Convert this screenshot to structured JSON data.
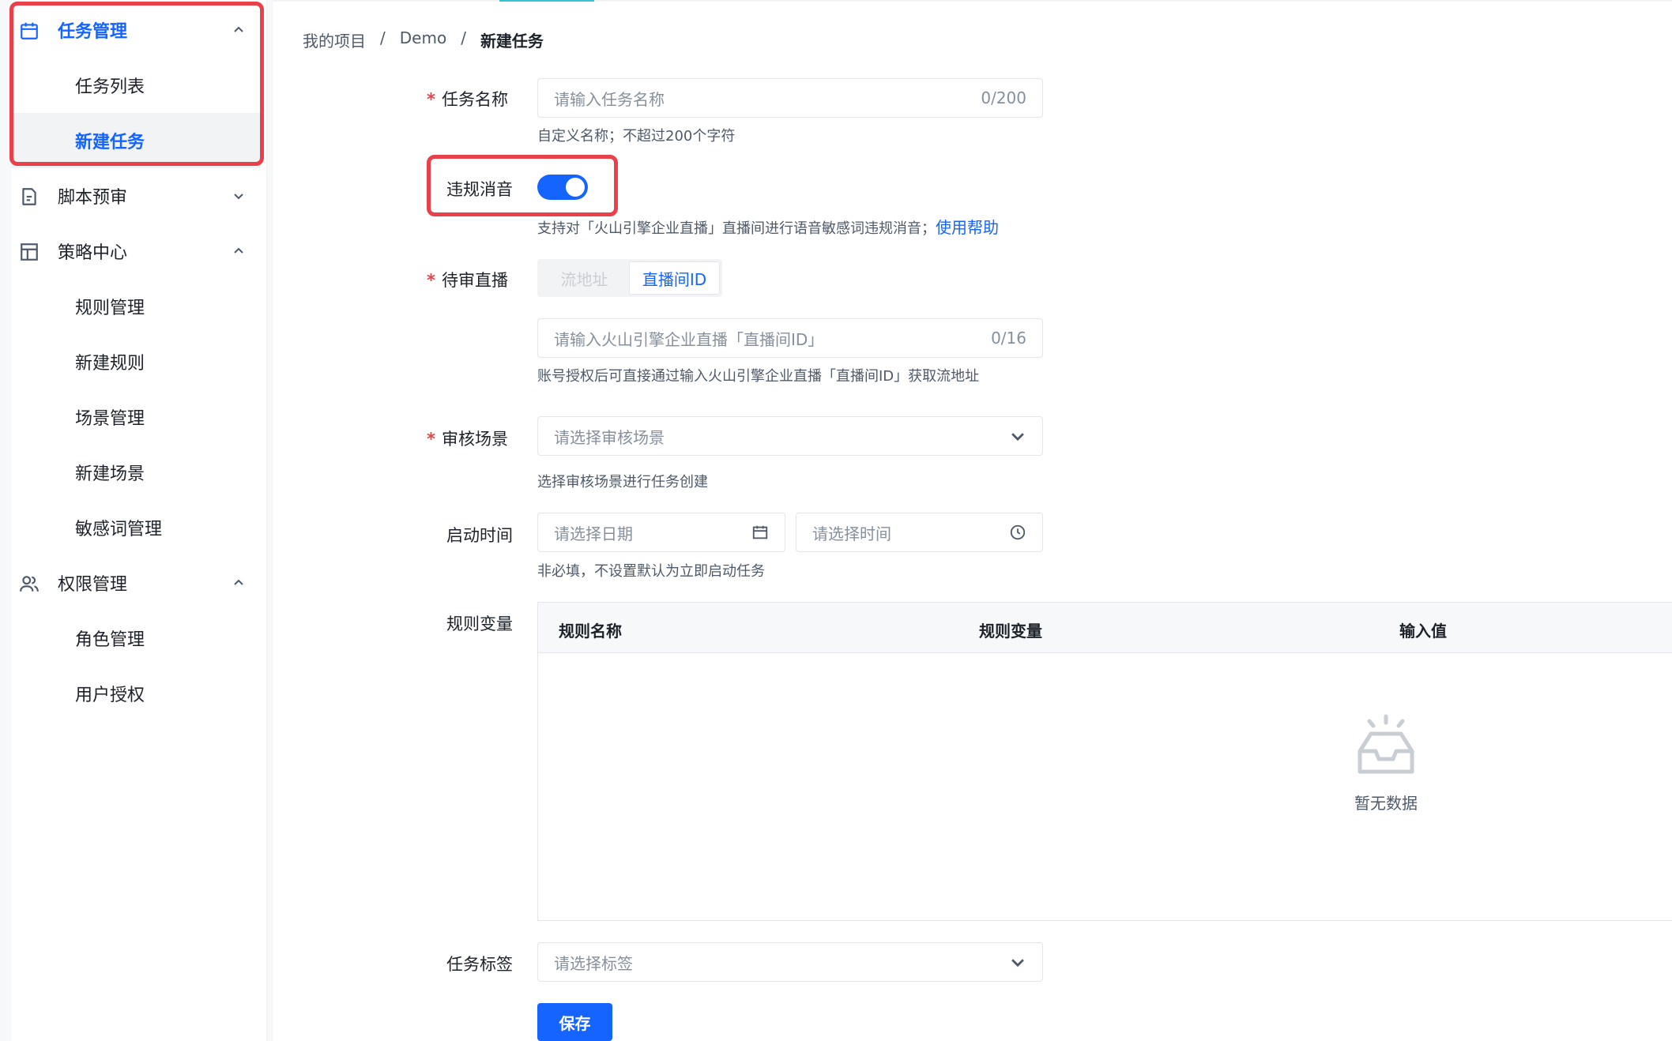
{
  "colors": {
    "primary": "#1664ff",
    "highlight": "#e8414a",
    "required": "#e8414a"
  },
  "sidebar": {
    "groups": [
      {
        "label": "任务管理",
        "icon": "calendar-icon",
        "expanded": true,
        "active": true,
        "items": [
          {
            "label": "任务列表"
          },
          {
            "label": "新建任务",
            "selected": true
          }
        ]
      },
      {
        "label": "脚本预审",
        "icon": "document-icon",
        "expanded": false
      },
      {
        "label": "策略中心",
        "icon": "layout-icon",
        "expanded": true,
        "items": [
          {
            "label": "规则管理"
          },
          {
            "label": "新建规则"
          },
          {
            "label": "场景管理"
          },
          {
            "label": "新建场景"
          },
          {
            "label": "敏感词管理"
          }
        ]
      },
      {
        "label": "权限管理",
        "icon": "users-icon",
        "expanded": true,
        "items": [
          {
            "label": "角色管理"
          },
          {
            "label": "用户授权"
          }
        ]
      }
    ]
  },
  "breadcrumb": {
    "items": [
      "我的项目",
      "Demo",
      "新建任务"
    ],
    "separator": "/"
  },
  "form": {
    "task_name": {
      "label": "任务名称",
      "required": true,
      "placeholder": "请输入任务名称",
      "count": "0/200",
      "hint": "自定义名称；不超过200个字符"
    },
    "mute": {
      "label": "违规消音",
      "enabled": true,
      "hint": "支持对「火山引擎企业直播」直播间进行语音敏感词违规消音；",
      "help_link": "使用帮助"
    },
    "stream": {
      "label": "待审直播",
      "required": true,
      "options": [
        "流地址",
        "直播间ID"
      ],
      "selected": "直播间ID",
      "placeholder": "请输入火山引擎企业直播「直播间ID」",
      "count": "0/16",
      "hint": "账号授权后可直接通过输入火山引擎企业直播「直播间ID」获取流地址"
    },
    "scene": {
      "label": "审核场景",
      "required": true,
      "placeholder": "请选择审核场景",
      "hint": "选择审核场景进行任务创建"
    },
    "start_time": {
      "label": "启动时间",
      "date_placeholder": "请选择日期",
      "time_placeholder": "请选择时间",
      "hint": "非必填，不设置默认为立即启动任务"
    },
    "rule_vars": {
      "label": "规则变量",
      "columns": [
        "规则名称",
        "规则变量",
        "输入值"
      ],
      "empty_text": "暂无数据"
    },
    "tags": {
      "label": "任务标签",
      "placeholder": "请选择标签"
    },
    "save_label": "保存"
  }
}
